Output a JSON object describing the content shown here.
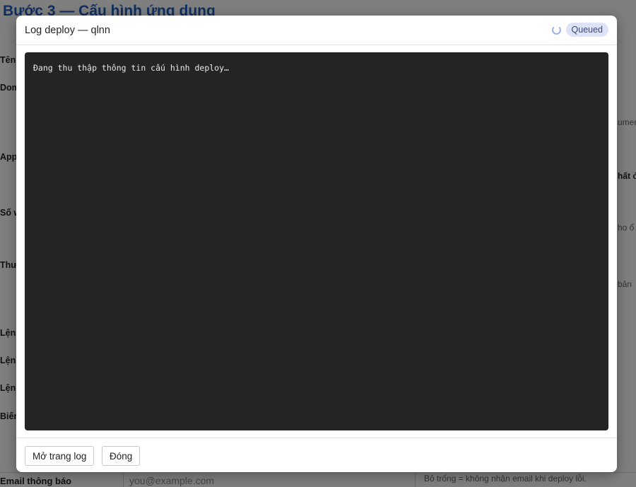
{
  "background": {
    "page_title": "Bước 3 — Cấu hình ứng dụng",
    "field_labels": [
      "Tên",
      "Dom",
      "App",
      "Số w",
      "Thư",
      "Lệnh",
      "Lệnh",
      "Lệnh",
      "Biến"
    ],
    "right_hints": [
      "umen",
      "hất ở",
      "ho ổ",
      "bản"
    ],
    "email_label": "Email thông báo",
    "email_placeholder": "you@example.com",
    "email_hint": "Bỏ trống = không nhận email khi deploy lỗi."
  },
  "modal": {
    "title": "Log deploy — qlnn",
    "status": "Queued",
    "log_text": "Đang thu thập thông tin cấu hình deploy…",
    "open_log_button": "Mở trang log",
    "close_button": "Đóng"
  }
}
